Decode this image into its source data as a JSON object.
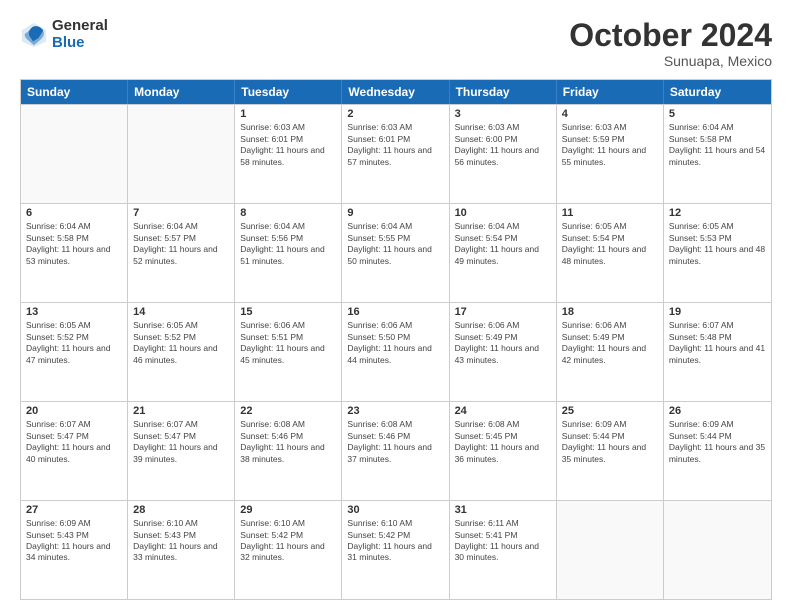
{
  "header": {
    "logo_general": "General",
    "logo_blue": "Blue",
    "month_title": "October 2024",
    "location": "Sunuapa, Mexico"
  },
  "days_of_week": [
    "Sunday",
    "Monday",
    "Tuesday",
    "Wednesday",
    "Thursday",
    "Friday",
    "Saturday"
  ],
  "weeks": [
    [
      {
        "day": "",
        "sunrise": "",
        "sunset": "",
        "daylight": ""
      },
      {
        "day": "",
        "sunrise": "",
        "sunset": "",
        "daylight": ""
      },
      {
        "day": "1",
        "sunrise": "Sunrise: 6:03 AM",
        "sunset": "Sunset: 6:01 PM",
        "daylight": "Daylight: 11 hours and 58 minutes."
      },
      {
        "day": "2",
        "sunrise": "Sunrise: 6:03 AM",
        "sunset": "Sunset: 6:01 PM",
        "daylight": "Daylight: 11 hours and 57 minutes."
      },
      {
        "day": "3",
        "sunrise": "Sunrise: 6:03 AM",
        "sunset": "Sunset: 6:00 PM",
        "daylight": "Daylight: 11 hours and 56 minutes."
      },
      {
        "day": "4",
        "sunrise": "Sunrise: 6:03 AM",
        "sunset": "Sunset: 5:59 PM",
        "daylight": "Daylight: 11 hours and 55 minutes."
      },
      {
        "day": "5",
        "sunrise": "Sunrise: 6:04 AM",
        "sunset": "Sunset: 5:58 PM",
        "daylight": "Daylight: 11 hours and 54 minutes."
      }
    ],
    [
      {
        "day": "6",
        "sunrise": "Sunrise: 6:04 AM",
        "sunset": "Sunset: 5:58 PM",
        "daylight": "Daylight: 11 hours and 53 minutes."
      },
      {
        "day": "7",
        "sunrise": "Sunrise: 6:04 AM",
        "sunset": "Sunset: 5:57 PM",
        "daylight": "Daylight: 11 hours and 52 minutes."
      },
      {
        "day": "8",
        "sunrise": "Sunrise: 6:04 AM",
        "sunset": "Sunset: 5:56 PM",
        "daylight": "Daylight: 11 hours and 51 minutes."
      },
      {
        "day": "9",
        "sunrise": "Sunrise: 6:04 AM",
        "sunset": "Sunset: 5:55 PM",
        "daylight": "Daylight: 11 hours and 50 minutes."
      },
      {
        "day": "10",
        "sunrise": "Sunrise: 6:04 AM",
        "sunset": "Sunset: 5:54 PM",
        "daylight": "Daylight: 11 hours and 49 minutes."
      },
      {
        "day": "11",
        "sunrise": "Sunrise: 6:05 AM",
        "sunset": "Sunset: 5:54 PM",
        "daylight": "Daylight: 11 hours and 48 minutes."
      },
      {
        "day": "12",
        "sunrise": "Sunrise: 6:05 AM",
        "sunset": "Sunset: 5:53 PM",
        "daylight": "Daylight: 11 hours and 48 minutes."
      }
    ],
    [
      {
        "day": "13",
        "sunrise": "Sunrise: 6:05 AM",
        "sunset": "Sunset: 5:52 PM",
        "daylight": "Daylight: 11 hours and 47 minutes."
      },
      {
        "day": "14",
        "sunrise": "Sunrise: 6:05 AM",
        "sunset": "Sunset: 5:52 PM",
        "daylight": "Daylight: 11 hours and 46 minutes."
      },
      {
        "day": "15",
        "sunrise": "Sunrise: 6:06 AM",
        "sunset": "Sunset: 5:51 PM",
        "daylight": "Daylight: 11 hours and 45 minutes."
      },
      {
        "day": "16",
        "sunrise": "Sunrise: 6:06 AM",
        "sunset": "Sunset: 5:50 PM",
        "daylight": "Daylight: 11 hours and 44 minutes."
      },
      {
        "day": "17",
        "sunrise": "Sunrise: 6:06 AM",
        "sunset": "Sunset: 5:49 PM",
        "daylight": "Daylight: 11 hours and 43 minutes."
      },
      {
        "day": "18",
        "sunrise": "Sunrise: 6:06 AM",
        "sunset": "Sunset: 5:49 PM",
        "daylight": "Daylight: 11 hours and 42 minutes."
      },
      {
        "day": "19",
        "sunrise": "Sunrise: 6:07 AM",
        "sunset": "Sunset: 5:48 PM",
        "daylight": "Daylight: 11 hours and 41 minutes."
      }
    ],
    [
      {
        "day": "20",
        "sunrise": "Sunrise: 6:07 AM",
        "sunset": "Sunset: 5:47 PM",
        "daylight": "Daylight: 11 hours and 40 minutes."
      },
      {
        "day": "21",
        "sunrise": "Sunrise: 6:07 AM",
        "sunset": "Sunset: 5:47 PM",
        "daylight": "Daylight: 11 hours and 39 minutes."
      },
      {
        "day": "22",
        "sunrise": "Sunrise: 6:08 AM",
        "sunset": "Sunset: 5:46 PM",
        "daylight": "Daylight: 11 hours and 38 minutes."
      },
      {
        "day": "23",
        "sunrise": "Sunrise: 6:08 AM",
        "sunset": "Sunset: 5:46 PM",
        "daylight": "Daylight: 11 hours and 37 minutes."
      },
      {
        "day": "24",
        "sunrise": "Sunrise: 6:08 AM",
        "sunset": "Sunset: 5:45 PM",
        "daylight": "Daylight: 11 hours and 36 minutes."
      },
      {
        "day": "25",
        "sunrise": "Sunrise: 6:09 AM",
        "sunset": "Sunset: 5:44 PM",
        "daylight": "Daylight: 11 hours and 35 minutes."
      },
      {
        "day": "26",
        "sunrise": "Sunrise: 6:09 AM",
        "sunset": "Sunset: 5:44 PM",
        "daylight": "Daylight: 11 hours and 35 minutes."
      }
    ],
    [
      {
        "day": "27",
        "sunrise": "Sunrise: 6:09 AM",
        "sunset": "Sunset: 5:43 PM",
        "daylight": "Daylight: 11 hours and 34 minutes."
      },
      {
        "day": "28",
        "sunrise": "Sunrise: 6:10 AM",
        "sunset": "Sunset: 5:43 PM",
        "daylight": "Daylight: 11 hours and 33 minutes."
      },
      {
        "day": "29",
        "sunrise": "Sunrise: 6:10 AM",
        "sunset": "Sunset: 5:42 PM",
        "daylight": "Daylight: 11 hours and 32 minutes."
      },
      {
        "day": "30",
        "sunrise": "Sunrise: 6:10 AM",
        "sunset": "Sunset: 5:42 PM",
        "daylight": "Daylight: 11 hours and 31 minutes."
      },
      {
        "day": "31",
        "sunrise": "Sunrise: 6:11 AM",
        "sunset": "Sunset: 5:41 PM",
        "daylight": "Daylight: 11 hours and 30 minutes."
      },
      {
        "day": "",
        "sunrise": "",
        "sunset": "",
        "daylight": ""
      },
      {
        "day": "",
        "sunrise": "",
        "sunset": "",
        "daylight": ""
      }
    ]
  ]
}
